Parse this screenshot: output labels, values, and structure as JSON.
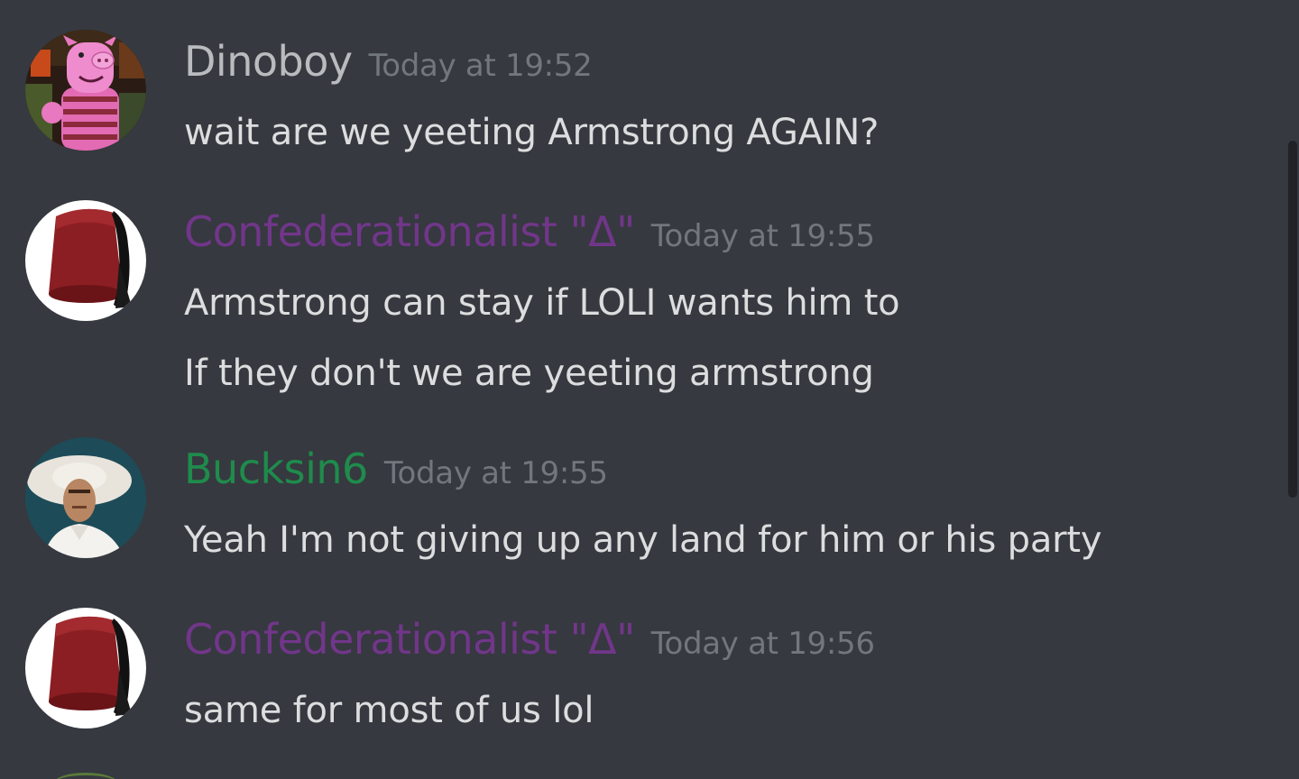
{
  "colors": {
    "background": "#36393f",
    "timestamp": "#72767d",
    "message_text": "#dcddde",
    "purple_role": "#71368a",
    "green_role": "#1f8b4c",
    "grey_name": "#b9bbbe"
  },
  "messages": [
    {
      "avatar_icon": "pink-pig-figure-avatar",
      "username": "Dinoboy",
      "name_color": "#b9bbbe",
      "timestamp": "Today at 19:52",
      "lines": [
        "wait are we yeeting Armstrong AGAIN?"
      ]
    },
    {
      "avatar_icon": "fez-hat-avatar",
      "username": "Confederationalist \"Δ\"",
      "name_color": "#71368a",
      "timestamp": "Today at 19:55",
      "lines": [
        "Armstrong can stay if LOLI wants him to",
        "If they don't we are yeeting armstrong"
      ]
    },
    {
      "avatar_icon": "man-in-white-hat-avatar",
      "username": "Bucksin6",
      "name_color": "#1f8b4c",
      "timestamp": "Today at 19:55",
      "lines": [
        "Yeah I'm not giving up any land for him or his party"
      ]
    },
    {
      "avatar_icon": "fez-hat-avatar",
      "username": "Confederationalist \"Δ\"",
      "name_color": "#71368a",
      "timestamp": "Today at 19:56",
      "lines": [
        "same for most of us lol"
      ]
    }
  ]
}
